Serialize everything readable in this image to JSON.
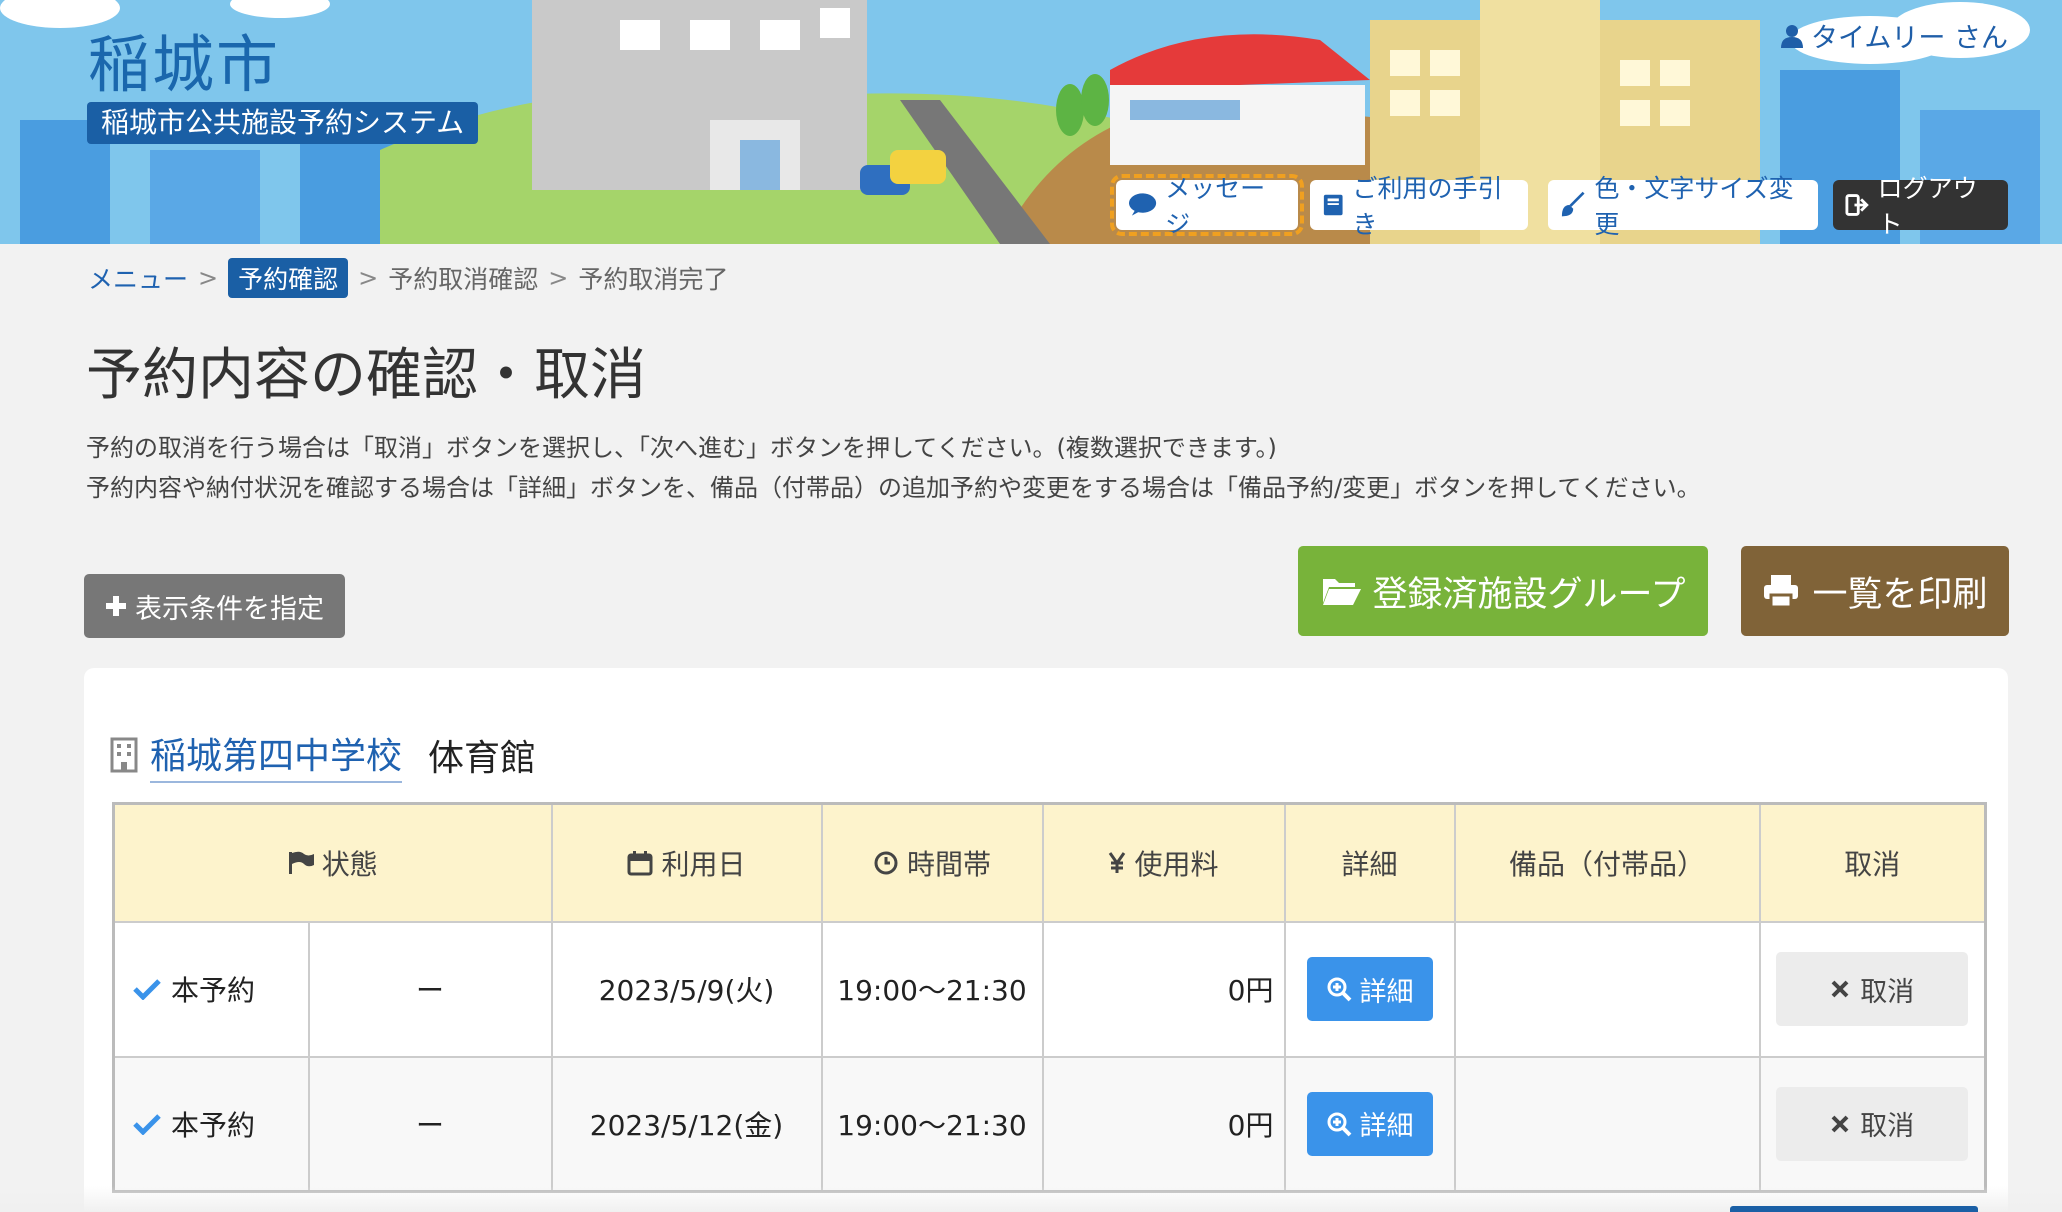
{
  "header": {
    "city_name": "稲城市",
    "system_name": "稲城市公共施設予約システム",
    "user_name": "タイムリー さん",
    "buttons": {
      "message": "メッセージ",
      "guide": "ご利用の手引き",
      "color_font": "色・文字サイズ変更",
      "logout": "ログアウト"
    }
  },
  "breadcrumb": {
    "items": [
      "メニュー",
      "予約確認",
      "予約取消確認",
      "予約取消完了"
    ],
    "separator": ">"
  },
  "page": {
    "title": "予約内容の確認・取消",
    "desc_line1": "予約の取消を行う場合は「取消」ボタンを選択し、「次へ進む」ボタンを押してください。(複数選択できます。)",
    "desc_line2": "予約内容や納付状況を確認する場合は「詳細」ボタンを、備品（付帯品）の追加予約や変更をする場合は「備品予約/変更」ボタンを押してください。"
  },
  "actions": {
    "filter": "表示条件を指定",
    "group": "登録済施設グループ",
    "print": "一覧を印刷"
  },
  "facility": {
    "name": "稲城第四中学校",
    "room": "体育館"
  },
  "table": {
    "headers": {
      "status": "状態",
      "date": "利用日",
      "time": "時間帯",
      "fee": "使用料",
      "detail": "詳細",
      "equipment": "備品（付帯品）",
      "cancel": "取消"
    },
    "rows": [
      {
        "status": "本予約",
        "sub": "ー",
        "date": "2023/5/9(火)",
        "time": "19:00〜21:30",
        "fee": "0円",
        "detail": "詳細",
        "equipment": "",
        "cancel": "取消"
      },
      {
        "status": "本予約",
        "sub": "ー",
        "date": "2023/5/12(金)",
        "time": "19:00〜21:30",
        "fee": "0円",
        "detail": "詳細",
        "equipment": "",
        "cancel": "取消"
      }
    ]
  },
  "colors": {
    "primary_blue": "#1a5fa5",
    "link_blue": "#1f62b0",
    "green": "#78b33a",
    "brown": "#806338",
    "table_header": "#fdf3cc",
    "detail_blue": "#3a93ea"
  }
}
